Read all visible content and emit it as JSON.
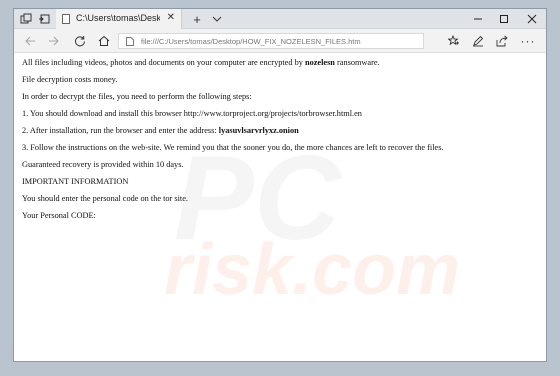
{
  "tab": {
    "title": "C:\\Users\\tomas\\Desktop\\HOW_FIX_NOZELESN_FILES.htm"
  },
  "address": {
    "url": "file:///C:/Users/tomas/Desktop/HOW_FIX_NOZELESN_FILES.htm"
  },
  "watermark": {
    "line1": "PC",
    "line2": "risk.com"
  },
  "note": {
    "p1_before": "All files including videos, photos and documents on your computer are encrypted by ",
    "p1_bold": "nozelesn",
    "p1_after": " ransomware.",
    "p2": "File decryption costs money.",
    "p3": "In order to decrypt the files, you need to perform the following steps:",
    "p4": "1. You should download and install this browser http://www.torproject.org/projects/torbrowser.html.en",
    "p5_before": "2. After installation, run the browser and enter the address: ",
    "p5_bold": "lyasuvlsarvrlyxz.onion",
    "p6": "3. Follow the instructions on the web-site. We remind you that the sooner you do, the more chances are left to recover the files.",
    "p7": "Guaranteed recovery is provided within 10 days.",
    "p8": "IMPORTANT INFORMATION",
    "p9": "You should enter the personal code on the tor site.",
    "p10": "Your Personal CODE:"
  }
}
